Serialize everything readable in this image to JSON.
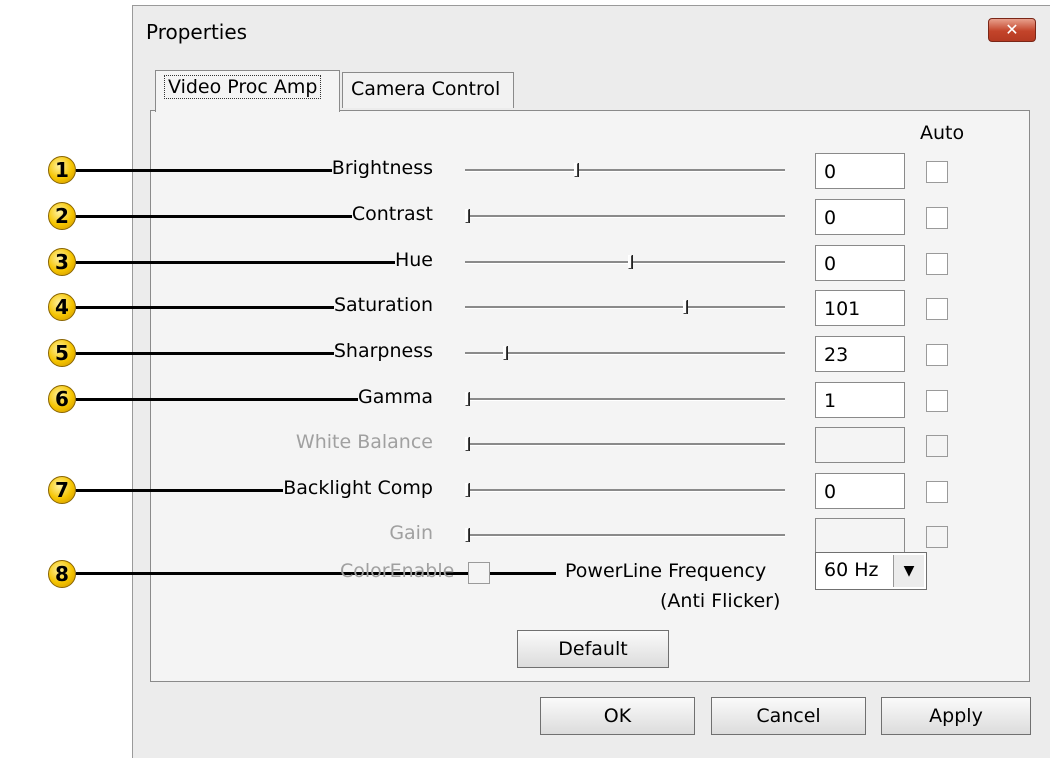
{
  "window": {
    "title": "Properties",
    "close_glyph": "✕"
  },
  "tabs": [
    {
      "label": "Video Proc Amp",
      "active": true
    },
    {
      "label": "Camera Control",
      "active": false
    }
  ],
  "auto_header": "Auto",
  "rows": [
    {
      "callout": "1",
      "label": "Brightness",
      "value": "0",
      "slider_fraction": 0.34,
      "enabled": true
    },
    {
      "callout": "2",
      "label": "Contrast",
      "value": "0",
      "slider_fraction": 0.0,
      "enabled": true
    },
    {
      "callout": "3",
      "label": "Hue",
      "value": "0",
      "slider_fraction": 0.51,
      "enabled": true
    },
    {
      "callout": "4",
      "label": "Saturation",
      "value": "101",
      "slider_fraction": 0.68,
      "enabled": true
    },
    {
      "callout": "5",
      "label": "Sharpness",
      "value": "23",
      "slider_fraction": 0.12,
      "enabled": true
    },
    {
      "callout": "6",
      "label": "Gamma",
      "value": "1",
      "slider_fraction": 0.0,
      "enabled": true
    },
    {
      "callout": "",
      "label": "White Balance",
      "value": "",
      "slider_fraction": 0.0,
      "enabled": false
    },
    {
      "callout": "7",
      "label": "Backlight Comp",
      "value": "0",
      "slider_fraction": 0.0,
      "enabled": true
    },
    {
      "callout": "",
      "label": "Gain",
      "value": "",
      "slider_fraction": 0.0,
      "enabled": false
    }
  ],
  "color_enable_label": "ColorEnable",
  "powerline": {
    "callout": "8",
    "label": "PowerLine Frequency",
    "sublabel": "(Anti Flicker)",
    "value": "60 Hz",
    "arrow": "▼"
  },
  "buttons": {
    "default": "Default",
    "ok": "OK",
    "cancel": "Cancel",
    "apply": "Apply"
  }
}
